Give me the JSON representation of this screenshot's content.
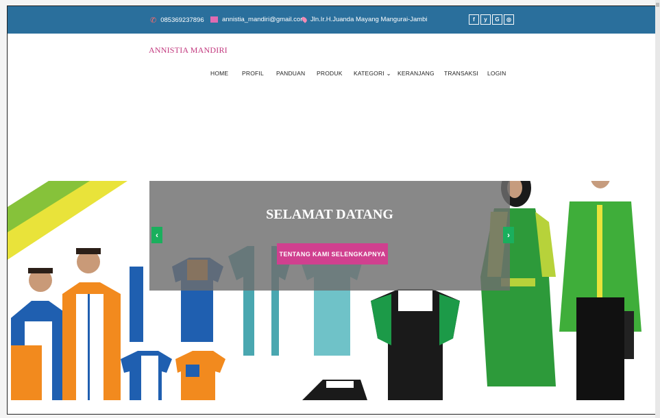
{
  "topbar": {
    "phone": "085369237896",
    "email": "annistia_mandiri@gmail.com",
    "address": "Jln.Ir.H.Juanda Mayang Mangurai-Jambi",
    "social": [
      "f",
      "y",
      "G",
      "◎"
    ],
    "background": "#2a6f9c"
  },
  "brand": {
    "name": "ANNISTIA MANDIRI",
    "color": "#c2387e"
  },
  "nav": {
    "items": [
      {
        "label": "HOME"
      },
      {
        "label": "PROFIL"
      },
      {
        "label": "PANDUAN"
      },
      {
        "label": "PRODUK"
      },
      {
        "label": "KATEGORI ⌄"
      },
      {
        "label": "KERANJANG"
      },
      {
        "label": "TRANSAKSI"
      },
      {
        "label": "LOGIN"
      }
    ]
  },
  "hero": {
    "title": "SELAMAT DATANG",
    "cta_label": "TENTANG KAMI SELENGKAPNYA",
    "prev_icon": "‹",
    "next_icon": "›",
    "accent": "#d0408f",
    "arrow_color": "#1aaf5d"
  }
}
